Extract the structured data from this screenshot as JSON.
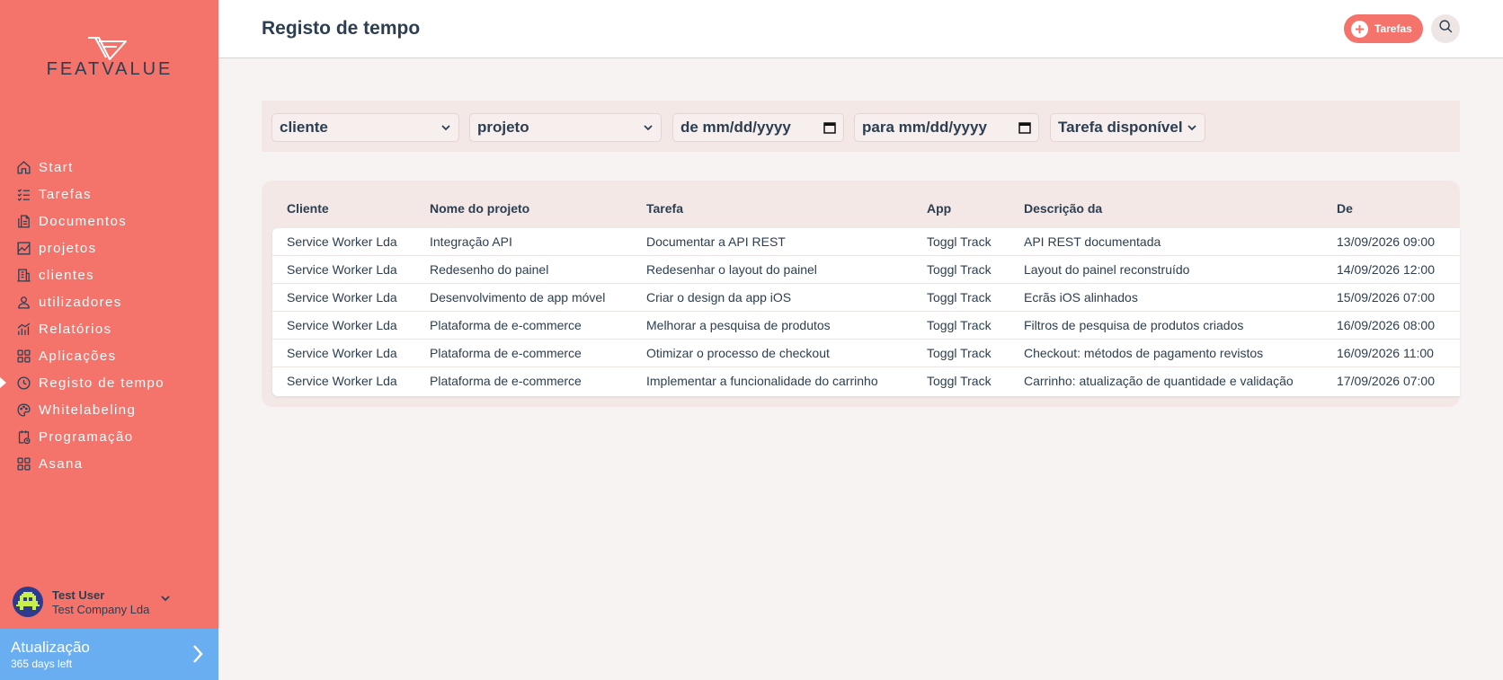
{
  "brand": {
    "logo_text": "FEATVALUE"
  },
  "sidebar": {
    "items": [
      {
        "label": "Start",
        "icon": "home-icon"
      },
      {
        "label": "Tarefas",
        "icon": "checklist-icon"
      },
      {
        "label": "Documentos",
        "icon": "documents-icon"
      },
      {
        "label": "projetos",
        "icon": "chart-icon"
      },
      {
        "label": "clientes",
        "icon": "building-icon"
      },
      {
        "label": "utilizadores",
        "icon": "user-icon"
      },
      {
        "label": "Relatórios",
        "icon": "bar-chart-icon"
      },
      {
        "label": "Aplicações",
        "icon": "apps-icon"
      },
      {
        "label": "Registo de tempo",
        "icon": "clock-icon",
        "active": true
      },
      {
        "label": "Whitelabeling",
        "icon": "palette-icon"
      },
      {
        "label": "Programação",
        "icon": "calendar-clock-icon"
      },
      {
        "label": "Asana",
        "icon": "apps-icon"
      }
    ],
    "user": {
      "name": "Test User",
      "company": "Test Company Lda"
    },
    "upgrade": {
      "title": "Atualização",
      "subtitle": "365 days left"
    }
  },
  "header": {
    "title": "Registo de tempo",
    "tasks_button": "Tarefas"
  },
  "filters": {
    "client": "cliente",
    "project": "projeto",
    "from": "de mm/dd/yyyy",
    "to": "para mm/dd/yyyy",
    "task": "Tarefa disponível"
  },
  "table": {
    "columns": [
      "Cliente",
      "Nome do projeto",
      "Tarefa",
      "App",
      "Descrição da",
      "De"
    ],
    "rows": [
      [
        "Service Worker Lda",
        "Integração API",
        "Documentar a API REST",
        "Toggl Track",
        "API REST documentada",
        "13/09/2026 09:00"
      ],
      [
        "Service Worker Lda",
        "Redesenho do painel",
        "Redesenhar o layout do painel",
        "Toggl Track",
        "Layout do painel reconstruído",
        "14/09/2026 12:00"
      ],
      [
        "Service Worker Lda",
        "Desenvolvimento de app móvel",
        "Criar o design da app iOS",
        "Toggl Track",
        "Ecrãs iOS alinhados",
        "15/09/2026 07:00"
      ],
      [
        "Service Worker Lda",
        "Plataforma de e-commerce",
        "Melhorar a pesquisa de produtos",
        "Toggl Track",
        "Filtros de pesquisa de produtos criados",
        "16/09/2026 08:00"
      ],
      [
        "Service Worker Lda",
        "Plataforma de e-commerce",
        "Otimizar o processo de checkout",
        "Toggl Track",
        "Checkout: métodos de pagamento revistos",
        "16/09/2026 11:00"
      ],
      [
        "Service Worker Lda",
        "Plataforma de e-commerce",
        "Implementar a funcionalidade do carrinho",
        "Toggl Track",
        "Carrinho: atualização de quantidade e validação",
        "17/09/2026 07:00"
      ]
    ]
  },
  "colors": {
    "sidebar": "#f4736b",
    "upgrade": "#6aaef2",
    "text": "#2c3e50",
    "background": "#f7f3f2"
  }
}
